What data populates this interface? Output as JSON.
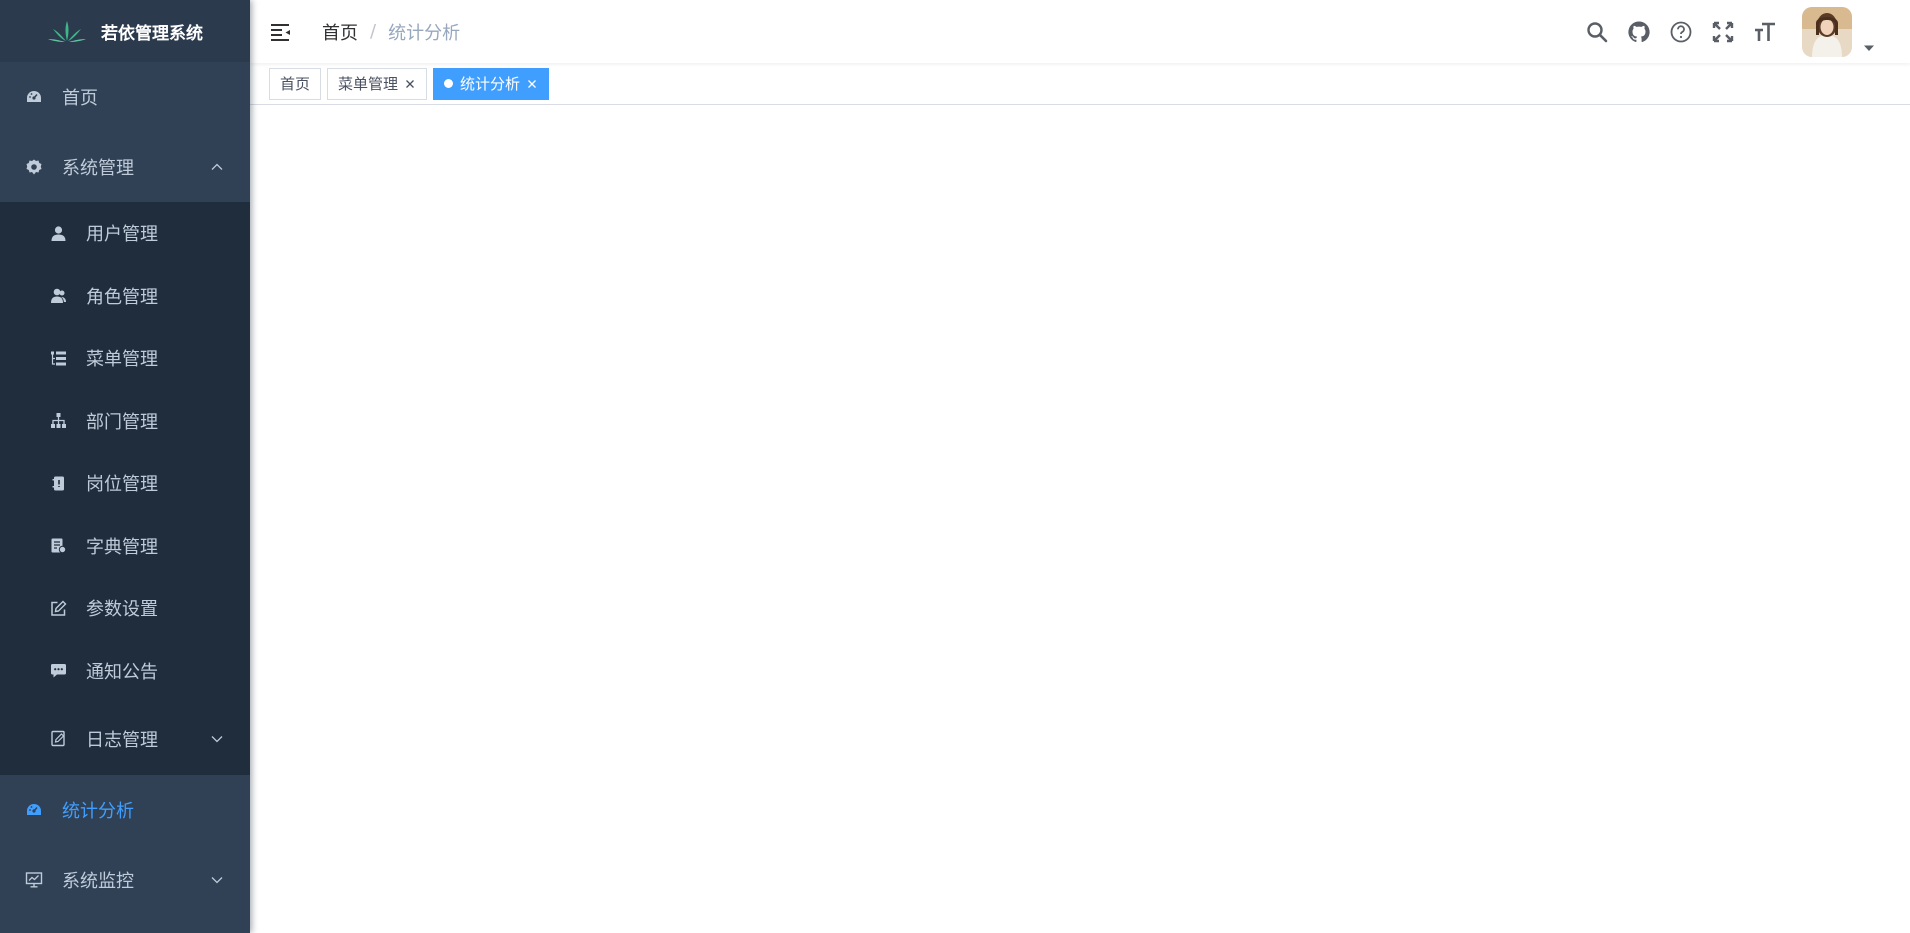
{
  "app": {
    "title": "若依管理系统"
  },
  "sidebar": {
    "home": "首页",
    "system": "系统管理",
    "system_items": [
      {
        "label": "用户管理",
        "icon": "user-icon"
      },
      {
        "label": "角色管理",
        "icon": "peoples-icon"
      },
      {
        "label": "菜单管理",
        "icon": "tree-table-icon"
      },
      {
        "label": "部门管理",
        "icon": "tree-icon"
      },
      {
        "label": "岗位管理",
        "icon": "post-icon"
      },
      {
        "label": "字典管理",
        "icon": "dict-icon"
      },
      {
        "label": "参数设置",
        "icon": "edit-icon"
      },
      {
        "label": "通知公告",
        "icon": "message-icon"
      },
      {
        "label": "日志管理",
        "icon": "log-icon"
      }
    ],
    "stats": "统计分析",
    "monitor": "系统监控"
  },
  "navbar": {
    "breadcrumb_home": "首页",
    "breadcrumb_sep": "/",
    "breadcrumb_current": "统计分析"
  },
  "tags": [
    {
      "label": "首页",
      "active": false,
      "closable": false
    },
    {
      "label": "菜单管理",
      "active": false,
      "closable": true
    },
    {
      "label": "统计分析",
      "active": true,
      "closable": true
    }
  ],
  "colors": {
    "sidebar_bg": "#304156",
    "submenu_bg": "#1f2d3d",
    "accent": "#409eff",
    "menu_text": "#bfcbd9"
  }
}
